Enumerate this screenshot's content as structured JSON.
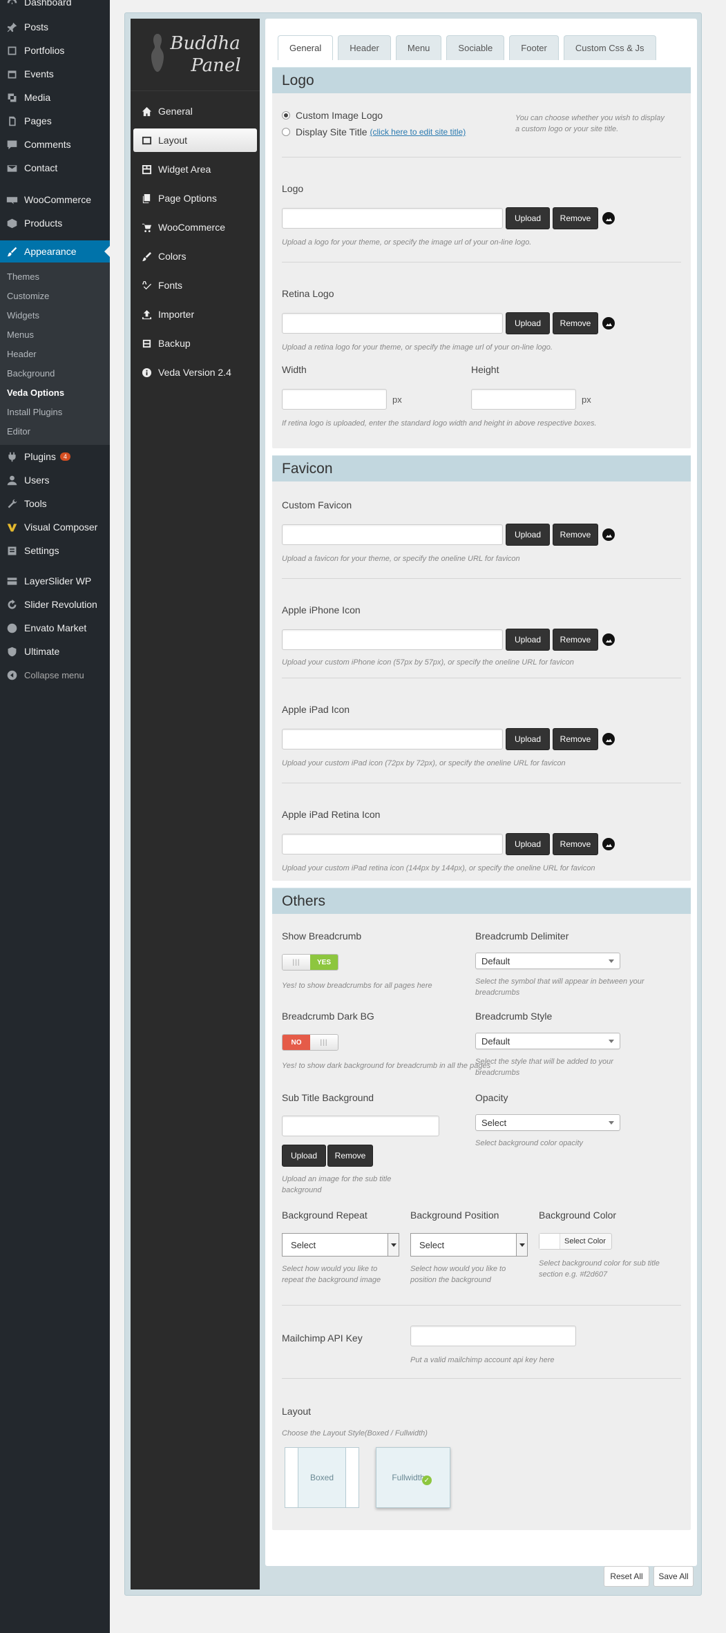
{
  "wp_menu": {
    "dashboard": "Dashboard",
    "posts": "Posts",
    "portfolios": "Portfolios",
    "events": "Events",
    "media": "Media",
    "pages": "Pages",
    "comments": "Comments",
    "contact": "Contact",
    "woocommerce": "WooCommerce",
    "products": "Products",
    "appearance": "Appearance",
    "appearance_sub": [
      "Themes",
      "Customize",
      "Widgets",
      "Menus",
      "Header",
      "Background",
      "Veda Options",
      "Install Plugins",
      "Editor"
    ],
    "plugins": "Plugins",
    "plugins_badge": "4",
    "users": "Users",
    "tools": "Tools",
    "visual_composer": "Visual Composer",
    "settings": "Settings",
    "layerslider": "LayerSlider WP",
    "slider_revolution": "Slider Revolution",
    "envato_market": "Envato Market",
    "ultimate": "Ultimate",
    "collapse": "Collapse menu"
  },
  "panel": {
    "logo_line1": "Buddha",
    "logo_line2": "Panel",
    "nav": [
      "General",
      "Layout",
      "Widget Area",
      "Page Options",
      "WooCommerce",
      "Colors",
      "Fonts",
      "Importer",
      "Backup",
      "Veda Version 2.4"
    ],
    "tabs": [
      "General",
      "Header",
      "Menu",
      "Sociable",
      "Footer",
      "Custom Css & Js"
    ]
  },
  "logo_section": {
    "title": "Logo",
    "radio_custom": "Custom Image Logo",
    "radio_site_title": "Display Site Title",
    "site_title_link": "(click here to edit site title)",
    "radio_hint": "You can choose whether you wish to display a custom logo or your site title.",
    "logo_label": "Logo",
    "logo_hint": "Upload a logo for your theme, or specify the image url of your on-line logo.",
    "retina_label": "Retina Logo",
    "retina_hint": "Upload a retina logo for your theme, or specify the image url of your on-line logo.",
    "width_label": "Width",
    "height_label": "Height",
    "px": "px",
    "size_hint": "If retina logo is uploaded, enter the standard logo width and height in above respective boxes."
  },
  "favicon_section": {
    "title": "Favicon",
    "custom_label": "Custom Favicon",
    "custom_hint": "Upload a favicon for your theme, or specify the oneline URL for favicon",
    "iphone_label": "Apple iPhone Icon",
    "iphone_hint": "Upload your custom iPhone icon (57px by 57px), or specify the oneline URL for favicon",
    "ipad_label": "Apple iPad Icon",
    "ipad_hint": "Upload your custom iPad icon (72px by 72px), or specify the oneline URL for favicon",
    "ipad_retina_label": "Apple iPad Retina Icon",
    "ipad_retina_hint": "Upload your custom iPad retina icon (144px by 144px), or specify the oneline URL for favicon"
  },
  "buttons": {
    "upload": "Upload",
    "remove": "Remove",
    "reset_all": "Reset All",
    "save_all": "Save All"
  },
  "others_section": {
    "title": "Others",
    "show_breadcrumb_label": "Show Breadcrumb",
    "show_breadcrumb_state": "YES",
    "show_breadcrumb_hint": "Yes! to show breadcrumbs for all pages here",
    "delimiter_label": "Breadcrumb Delimiter",
    "delimiter_value": "Default",
    "delimiter_hint": "Select the symbol that will appear in between your breadcrumbs",
    "dark_bg_label": "Breadcrumb Dark BG",
    "dark_bg_state": "NO",
    "dark_bg_hint": "Yes! to show dark background for breadcrumb in all the pages",
    "style_label": "Breadcrumb Style",
    "style_value": "Default",
    "style_hint": "Select the style that will be added to your breadcrumbs",
    "subtitle_bg_label": "Sub Title Background",
    "subtitle_bg_hint": "Upload an image for the sub title background",
    "opacity_label": "Opacity",
    "opacity_value": "Select",
    "opacity_hint": "Select background color opacity",
    "bg_repeat_label": "Background Repeat",
    "bg_repeat_value": "Select",
    "bg_repeat_hint": "Select how would you like to repeat the background image",
    "bg_position_label": "Background Position",
    "bg_position_value": "Select",
    "bg_position_hint": "Select how would you like to position the background",
    "bg_color_label": "Background Color",
    "bg_color_button": "Select Color",
    "bg_color_hint": "Select background color for sub title section e.g. #f2d607",
    "mailchimp_label": "Mailchimp API Key",
    "mailchimp_hint": "Put a valid mailchimp account api key here",
    "layout_label": "Layout",
    "layout_hint": "Choose the Layout Style(Boxed / Fullwidth)",
    "layout_boxed": "Boxed",
    "layout_fullwidth": "Fullwidth"
  }
}
